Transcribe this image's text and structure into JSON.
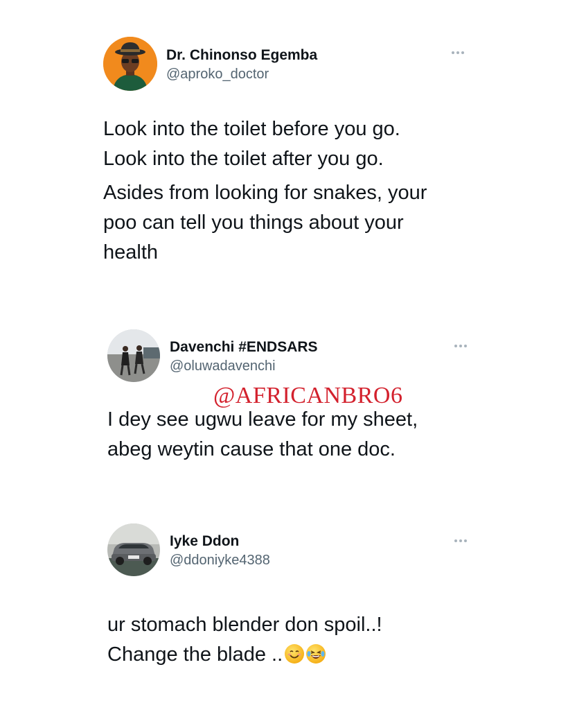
{
  "tweets": [
    {
      "name": "Dr. Chinonso Egemba",
      "handle": "@aproko_doctor",
      "avatar_icon": "profile-photo-man-with-hat",
      "paragraphs": [
        "Look into the toilet before you go.\nLook into the toilet after you go.",
        "Asides from looking for snakes, your poo can tell you things about your health"
      ]
    },
    {
      "name": "Davenchi #ENDSARS",
      "handle": "@oluwadavenchi",
      "avatar_icon": "profile-photo-two-people-outdoors",
      "paragraphs": [
        "I dey see ugwu leave for my sheet,\nabeg weytin cause that one doc."
      ]
    },
    {
      "name": "Iyke Ddon",
      "handle": "@ddoniyke4388",
      "avatar_icon": "profile-photo-car",
      "paragraphs": [
        "ur stomach blender don spoil..!\nChange the blade .."
      ],
      "emojis": [
        "smiling-face-emoji",
        "tears-of-joy-emoji"
      ]
    }
  ],
  "watermark": "@AFRICANBRO6",
  "colors": {
    "text": "#0f1419",
    "handle": "#536471",
    "watermark": "#d3212d",
    "avatar1_bg": "#f18a1d"
  }
}
